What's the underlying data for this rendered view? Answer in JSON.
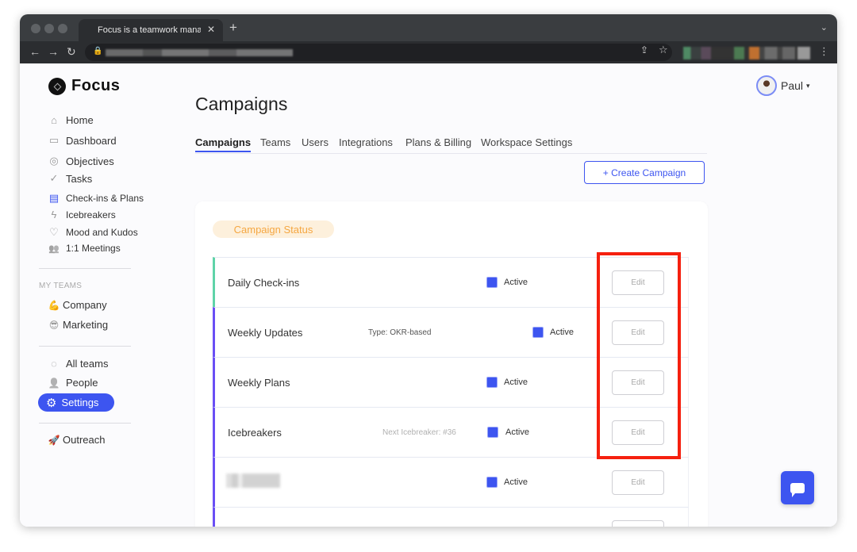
{
  "browser": {
    "tab_title": "Focus is a teamwork managem",
    "tab_close": "✕",
    "new_tab": "+",
    "tab_menu": "⌄",
    "back": "←",
    "forward": "→",
    "reload": "↻",
    "lock": "🔒",
    "share": "⇪",
    "bookmark": "☆",
    "more": "⋮"
  },
  "sidebar": {
    "logo_text": "Focus",
    "items": [
      {
        "label": "Home",
        "icon": "⌂"
      },
      {
        "label": "Dashboard",
        "icon": "▭"
      },
      {
        "label": "Objectives",
        "icon": "◎"
      },
      {
        "label": "Tasks",
        "icon": "✓"
      },
      {
        "label": "Check-ins & Plans",
        "icon": "▤"
      },
      {
        "label": "Icebreakers",
        "icon": "ϟ"
      },
      {
        "label": "Mood and Kudos",
        "icon": "♡"
      },
      {
        "label": "1:1 Meetings",
        "icon": "👥"
      }
    ],
    "my_teams_label": "MY TEAMS",
    "teams": [
      {
        "label": "Company",
        "icon": "💪"
      },
      {
        "label": "Marketing",
        "icon": "😎"
      }
    ],
    "bottom_items": [
      {
        "label": "All teams",
        "icon": "◌"
      },
      {
        "label": "People",
        "icon": "👤"
      },
      {
        "label": "Settings",
        "icon": "⚙"
      }
    ],
    "outreach": {
      "label": "Outreach",
      "icon": "🚀"
    }
  },
  "header": {
    "title": "Campaigns",
    "user_name": "Paul",
    "caret": "▾"
  },
  "tabs": [
    "Campaigns",
    "Teams",
    "Users",
    "Integrations",
    "Plans & Billing",
    "Workspace Settings"
  ],
  "create_button": "+ Create Campaign",
  "campaign_status_label": "Campaign Status",
  "campaigns": [
    {
      "name": "Daily Check-ins",
      "meta": "",
      "status": "Active",
      "edit": "Edit",
      "accent": "#5fd3a8"
    },
    {
      "name": "Weekly Updates",
      "meta": "Type: OKR-based",
      "status": "Active",
      "edit": "Edit",
      "accent": "#6a4ff5"
    },
    {
      "name": "Weekly Plans",
      "meta": "",
      "status": "Active",
      "edit": "Edit",
      "accent": "#6a4ff5"
    },
    {
      "name": "Icebreakers",
      "meta": "Next Icebreaker: #36",
      "status": "Active",
      "edit": "Edit",
      "accent": "#6a4ff5"
    },
    {
      "name": "",
      "meta": "",
      "status": "Active",
      "edit": "Edit",
      "accent": "#6a4ff5"
    },
    {
      "name": "",
      "meta": "",
      "status": "",
      "edit": "",
      "accent": "#6a4ff5"
    }
  ],
  "colors": {
    "accent": "#3d55f0",
    "highlight": "#f5200f",
    "status_pill_bg": "#fdf0dc",
    "status_pill_text": "#f5a742"
  }
}
